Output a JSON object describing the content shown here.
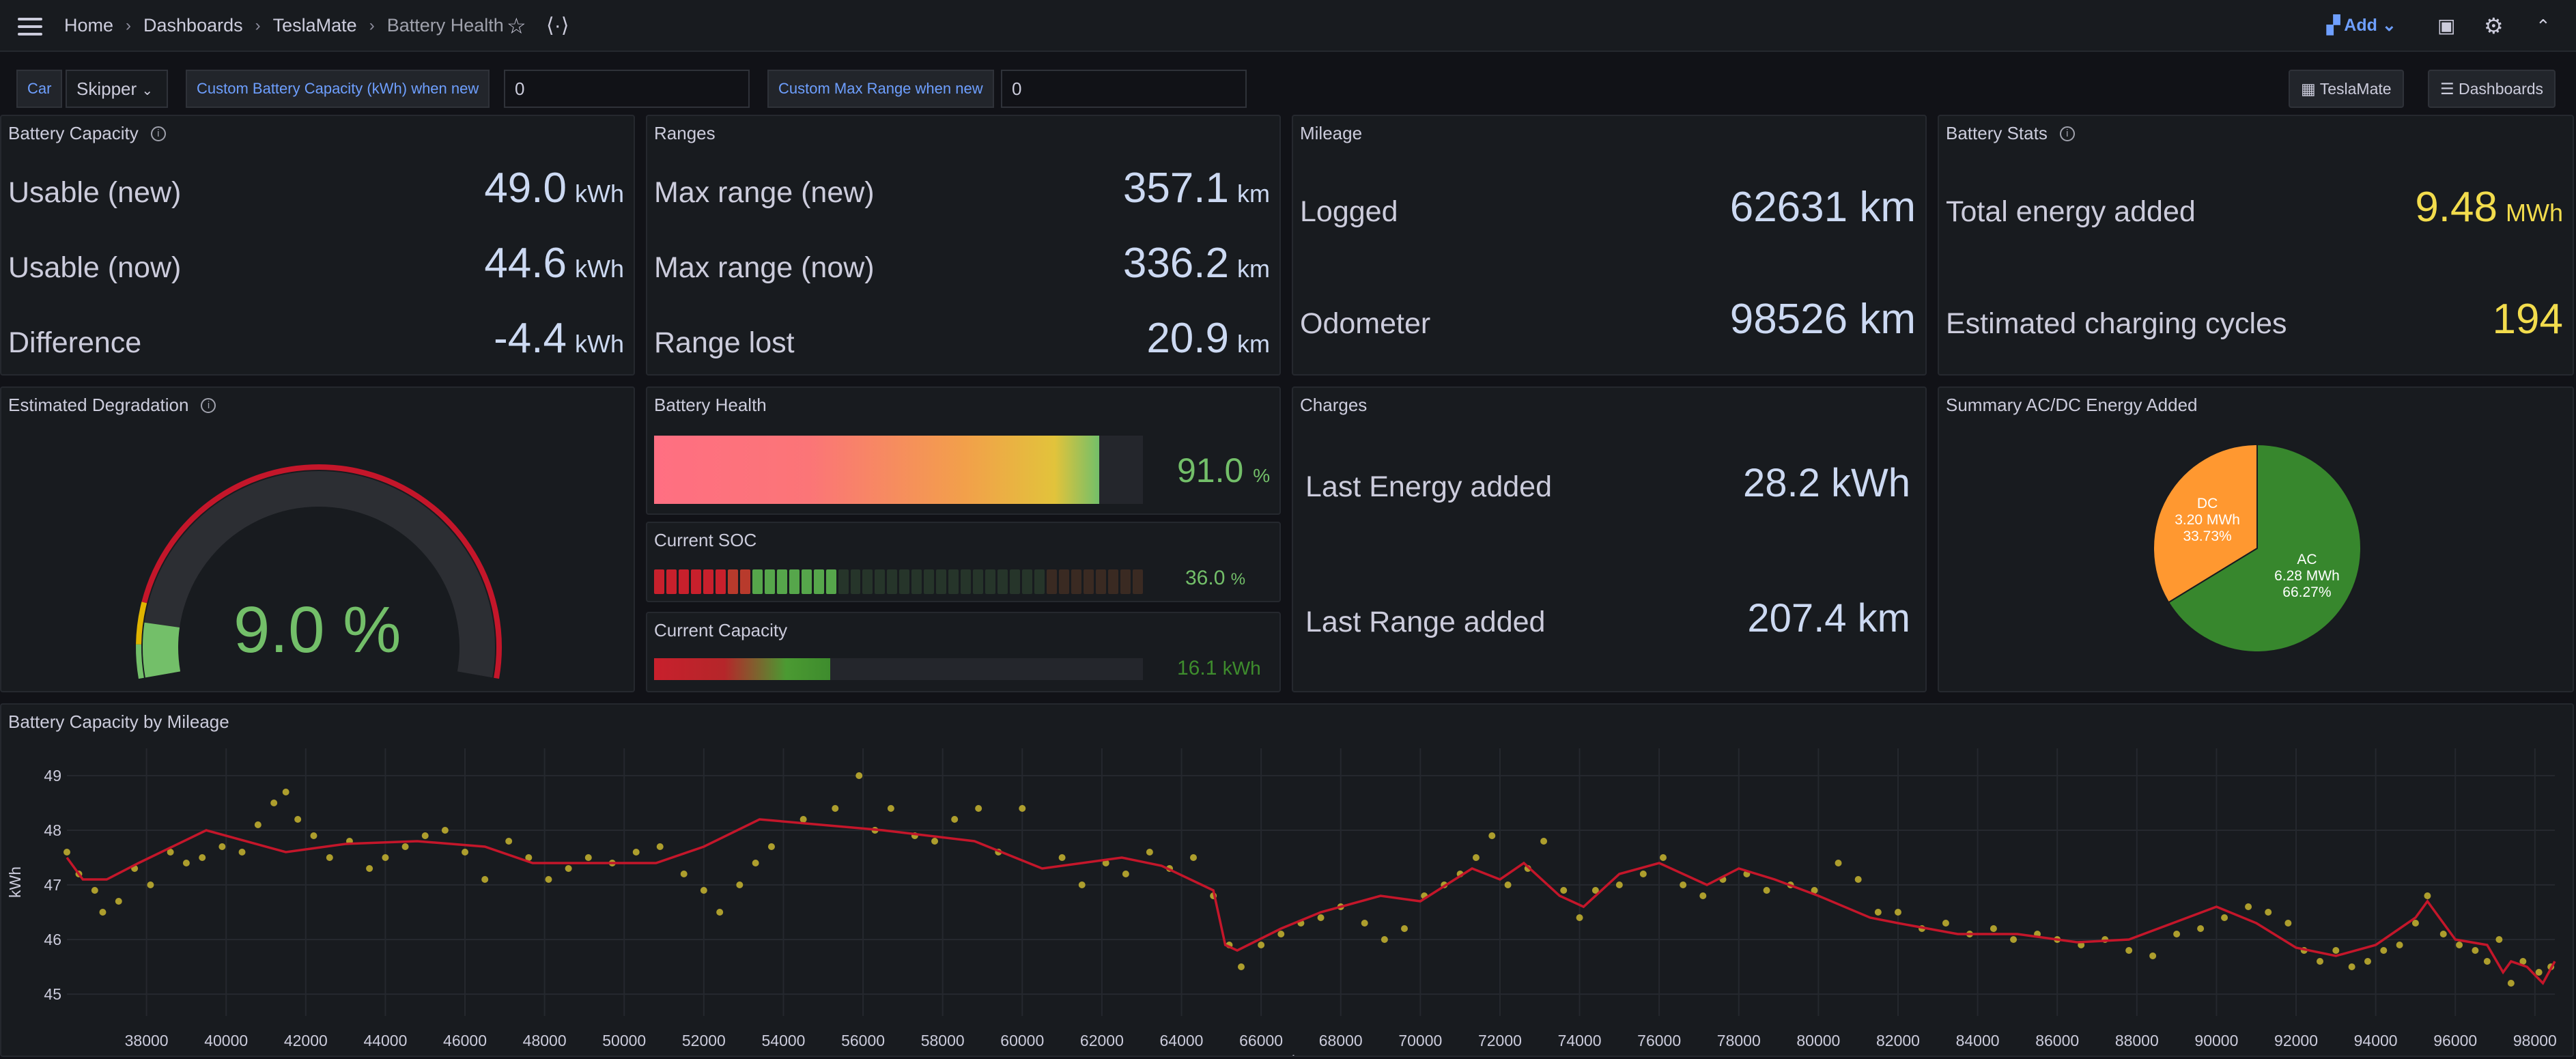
{
  "breadcrumb": {
    "home": "Home",
    "dashboards": "Dashboards",
    "folder": "TeslaMate",
    "current": "Battery Health"
  },
  "toolbar": {
    "add_label": "Add"
  },
  "variables": {
    "car_label": "Car",
    "car_value": "Skipper",
    "capacity_label": "Custom Battery Capacity (kWh) when new",
    "capacity_value": "0",
    "range_label": "Custom Max Range when new",
    "range_value": "0"
  },
  "nav_links": {
    "teslamate": "TeslaMate",
    "dashboards": "Dashboards"
  },
  "battery_capacity": {
    "title": "Battery Capacity",
    "rows": [
      {
        "label": "Usable (new)",
        "value": "49.0",
        "unit": "kWh"
      },
      {
        "label": "Usable (now)",
        "value": "44.6",
        "unit": "kWh"
      },
      {
        "label": "Difference",
        "value": "-4.4",
        "unit": "kWh"
      }
    ]
  },
  "ranges": {
    "title": "Ranges",
    "rows": [
      {
        "label": "Max range (new)",
        "value": "357.1",
        "unit": "km"
      },
      {
        "label": "Max range (now)",
        "value": "336.2",
        "unit": "km"
      },
      {
        "label": "Range lost",
        "value": "20.9",
        "unit": "km"
      }
    ]
  },
  "mileage": {
    "title": "Mileage",
    "rows": [
      {
        "label": "Logged",
        "value": "62631 km"
      },
      {
        "label": "Odometer",
        "value": "98526 km"
      }
    ]
  },
  "battery_stats": {
    "title": "Battery Stats",
    "rows": [
      {
        "label": "Total energy added",
        "value": "9.48",
        "unit": "MWh"
      },
      {
        "label": "Estimated charging cycles",
        "value": "194"
      }
    ],
    "accent": "#f2dc4d"
  },
  "degradation": {
    "title": "Estimated Degradation",
    "value": "9.0 %",
    "percent": 9.0,
    "color": "#73bf69"
  },
  "battery_health": {
    "title": "Battery Health",
    "value": "91.0",
    "unit": "%",
    "percent": 91.0
  },
  "current_soc": {
    "title": "Current SOC",
    "value": "36.0",
    "unit": "%",
    "percent": 36.0
  },
  "current_capacity": {
    "title": "Current Capacity",
    "value": "16.1",
    "unit": "kWh",
    "fraction": 0.36
  },
  "charges": {
    "title": "Charges",
    "rows": [
      {
        "label": "Last Energy added",
        "value": "28.2 kWh"
      },
      {
        "label": "Last Range added",
        "value": "207.4 km"
      }
    ]
  },
  "summary": {
    "title": "Summary AC/DC Energy Added",
    "slices": [
      {
        "name": "AC",
        "value": "6.28 MWh",
        "percent": "66.27%",
        "share": 66.27,
        "color": "#37872d"
      },
      {
        "name": "DC",
        "value": "3.20 MWh",
        "percent": "33.73%",
        "share": 33.73,
        "color": "#ff9830"
      }
    ]
  },
  "chart_data": {
    "type": "line",
    "title": "Battery Capacity by Mileage",
    "xlabel": "odometer",
    "ylabel": "kWh",
    "xlim": [
      36000,
      98500
    ],
    "ylim": [
      44.6,
      49.5
    ],
    "xticks": [
      38000,
      40000,
      42000,
      44000,
      46000,
      48000,
      50000,
      52000,
      54000,
      56000,
      58000,
      60000,
      62000,
      64000,
      66000,
      68000,
      70000,
      72000,
      74000,
      76000,
      78000,
      80000,
      82000,
      84000,
      86000,
      88000,
      90000,
      92000,
      94000,
      96000,
      98000
    ],
    "yticks": [
      45,
      46,
      47,
      48,
      49
    ],
    "series": [
      {
        "kind": "line",
        "color": "#c4162a",
        "points": [
          [
            36000,
            47.5
          ],
          [
            36400,
            47.1
          ],
          [
            37000,
            47.1
          ],
          [
            37800,
            47.4
          ],
          [
            39500,
            48.0
          ],
          [
            41500,
            47.6
          ],
          [
            43000,
            47.75
          ],
          [
            44800,
            47.8
          ],
          [
            46500,
            47.7
          ],
          [
            47700,
            47.4
          ],
          [
            49000,
            47.4
          ],
          [
            50800,
            47.4
          ],
          [
            52000,
            47.7
          ],
          [
            53400,
            48.2
          ],
          [
            56500,
            48.0
          ],
          [
            58800,
            47.8
          ],
          [
            60500,
            47.3
          ],
          [
            62500,
            47.5
          ],
          [
            63500,
            47.35
          ],
          [
            64800,
            46.9
          ],
          [
            65100,
            45.9
          ],
          [
            65400,
            45.8
          ],
          [
            66500,
            46.2
          ],
          [
            67500,
            46.5
          ],
          [
            69000,
            46.8
          ],
          [
            70000,
            46.7
          ],
          [
            71300,
            47.3
          ],
          [
            72000,
            47.1
          ],
          [
            72600,
            47.4
          ],
          [
            73500,
            46.8
          ],
          [
            74100,
            46.6
          ],
          [
            75000,
            47.2
          ],
          [
            76000,
            47.4
          ],
          [
            77200,
            47.0
          ],
          [
            78000,
            47.3
          ],
          [
            78900,
            47.1
          ],
          [
            80000,
            46.8
          ],
          [
            81300,
            46.4
          ],
          [
            82000,
            46.3
          ],
          [
            83500,
            46.1
          ],
          [
            85000,
            46.1
          ],
          [
            86500,
            45.95
          ],
          [
            87800,
            46.0
          ],
          [
            90000,
            46.6
          ],
          [
            91000,
            46.3
          ],
          [
            92000,
            45.85
          ],
          [
            93000,
            45.7
          ],
          [
            94000,
            45.9
          ],
          [
            95000,
            46.4
          ],
          [
            95300,
            46.7
          ],
          [
            96000,
            46.0
          ],
          [
            96800,
            45.9
          ],
          [
            97200,
            45.4
          ],
          [
            97400,
            45.6
          ],
          [
            97800,
            45.5
          ],
          [
            98200,
            45.2
          ],
          [
            98500,
            45.6
          ]
        ]
      },
      {
        "kind": "scatter",
        "color": "#c8b530",
        "points": [
          [
            36000,
            47.6
          ],
          [
            36300,
            47.2
          ],
          [
            36700,
            46.9
          ],
          [
            36900,
            46.5
          ],
          [
            37300,
            46.7
          ],
          [
            37700,
            47.3
          ],
          [
            38100,
            47.0
          ],
          [
            38600,
            47.6
          ],
          [
            39000,
            47.4
          ],
          [
            39400,
            47.5
          ],
          [
            39900,
            47.7
          ],
          [
            40400,
            47.6
          ],
          [
            40800,
            48.1
          ],
          [
            41200,
            48.5
          ],
          [
            41500,
            48.7
          ],
          [
            41800,
            48.2
          ],
          [
            42200,
            47.9
          ],
          [
            42600,
            47.5
          ],
          [
            43100,
            47.8
          ],
          [
            43600,
            47.3
          ],
          [
            44000,
            47.5
          ],
          [
            44500,
            47.7
          ],
          [
            45000,
            47.9
          ],
          [
            45500,
            48.0
          ],
          [
            46000,
            47.6
          ],
          [
            46500,
            47.1
          ],
          [
            47100,
            47.8
          ],
          [
            47600,
            47.5
          ],
          [
            48100,
            47.1
          ],
          [
            48600,
            47.3
          ],
          [
            49100,
            47.5
          ],
          [
            49700,
            47.4
          ],
          [
            50300,
            47.6
          ],
          [
            50900,
            47.7
          ],
          [
            51500,
            47.2
          ],
          [
            52000,
            46.9
          ],
          [
            52400,
            46.5
          ],
          [
            52900,
            47.0
          ],
          [
            53300,
            47.4
          ],
          [
            53700,
            47.7
          ],
          [
            54500,
            48.2
          ],
          [
            55300,
            48.4
          ],
          [
            55900,
            49.0
          ],
          [
            56300,
            48.0
          ],
          [
            56700,
            48.4
          ],
          [
            57300,
            47.9
          ],
          [
            57800,
            47.8
          ],
          [
            58300,
            48.2
          ],
          [
            58900,
            48.4
          ],
          [
            59400,
            47.6
          ],
          [
            60000,
            48.4
          ],
          [
            61000,
            47.5
          ],
          [
            61500,
            47.0
          ],
          [
            62100,
            47.4
          ],
          [
            62600,
            47.2
          ],
          [
            63200,
            47.6
          ],
          [
            63700,
            47.3
          ],
          [
            64300,
            47.5
          ],
          [
            64800,
            46.8
          ],
          [
            65200,
            45.9
          ],
          [
            65500,
            45.5
          ],
          [
            66000,
            45.9
          ],
          [
            66500,
            46.1
          ],
          [
            67000,
            46.3
          ],
          [
            67500,
            46.4
          ],
          [
            68000,
            46.6
          ],
          [
            68600,
            46.3
          ],
          [
            69100,
            46.0
          ],
          [
            69600,
            46.2
          ],
          [
            70100,
            46.8
          ],
          [
            70600,
            47.0
          ],
          [
            71000,
            47.2
          ],
          [
            71400,
            47.5
          ],
          [
            71800,
            47.9
          ],
          [
            72200,
            47.0
          ],
          [
            72700,
            47.3
          ],
          [
            73100,
            47.8
          ],
          [
            73600,
            46.9
          ],
          [
            74000,
            46.4
          ],
          [
            74400,
            46.9
          ],
          [
            75000,
            47.0
          ],
          [
            75600,
            47.2
          ],
          [
            76100,
            47.5
          ],
          [
            76600,
            47.0
          ],
          [
            77100,
            46.8
          ],
          [
            77600,
            47.1
          ],
          [
            78200,
            47.2
          ],
          [
            78700,
            46.9
          ],
          [
            79300,
            47.0
          ],
          [
            79900,
            46.9
          ],
          [
            80500,
            47.4
          ],
          [
            81000,
            47.1
          ],
          [
            81500,
            46.5
          ],
          [
            82000,
            46.5
          ],
          [
            82600,
            46.2
          ],
          [
            83200,
            46.3
          ],
          [
            83800,
            46.1
          ],
          [
            84400,
            46.2
          ],
          [
            84900,
            46.0
          ],
          [
            85500,
            46.1
          ],
          [
            86000,
            46.0
          ],
          [
            86600,
            45.9
          ],
          [
            87200,
            46.0
          ],
          [
            87800,
            45.8
          ],
          [
            88400,
            45.7
          ],
          [
            89000,
            46.1
          ],
          [
            89600,
            46.2
          ],
          [
            90200,
            46.4
          ],
          [
            90800,
            46.6
          ],
          [
            91300,
            46.5
          ],
          [
            91800,
            46.3
          ],
          [
            92200,
            45.8
          ],
          [
            92600,
            45.6
          ],
          [
            93000,
            45.8
          ],
          [
            93400,
            45.5
          ],
          [
            93800,
            45.6
          ],
          [
            94200,
            45.8
          ],
          [
            94600,
            45.9
          ],
          [
            95000,
            46.3
          ],
          [
            95300,
            46.8
          ],
          [
            95700,
            46.1
          ],
          [
            96100,
            45.9
          ],
          [
            96500,
            45.8
          ],
          [
            96800,
            45.6
          ],
          [
            97100,
            46.0
          ],
          [
            97400,
            45.2
          ],
          [
            97700,
            45.6
          ],
          [
            98100,
            45.4
          ],
          [
            98400,
            45.5
          ]
        ]
      }
    ]
  }
}
